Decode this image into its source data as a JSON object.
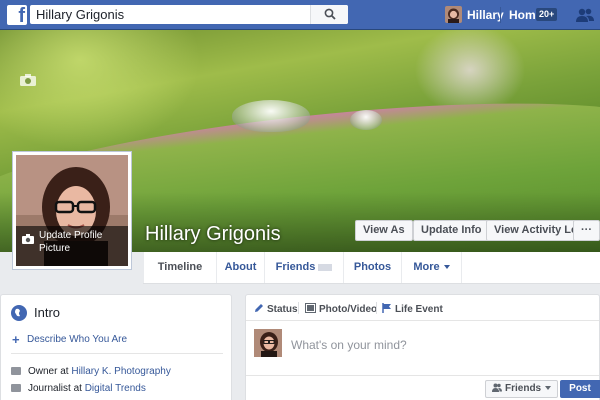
{
  "topbar": {
    "logo_letter": "f",
    "search_value": "Hillary Grigonis",
    "user_name": "Hillary",
    "home_label": "Home",
    "home_badge": "20+"
  },
  "profile": {
    "name": "Hillary Grigonis",
    "update_picture_label": "Update Profile Picture"
  },
  "cover_buttons": {
    "view_as": "View As",
    "update_info": "Update Info",
    "activity_log": "View Activity Log",
    "more_dots": "···"
  },
  "nav": {
    "timeline": "Timeline",
    "about": "About",
    "friends": "Friends",
    "photos": "Photos",
    "more": "More"
  },
  "intro": {
    "title": "Intro",
    "describe_plus": "+",
    "describe_link": "Describe Who You Are",
    "work": [
      {
        "role": "Owner at ",
        "place": "Hillary K. Photography"
      },
      {
        "role": "Journalist at ",
        "place": "Digital Trends"
      }
    ]
  },
  "composer": {
    "tabs": [
      "Status",
      "Photo/Video",
      "Life Event"
    ],
    "prompt": "What's on your mind?",
    "audience_label": "Friends",
    "post_label": "Post"
  },
  "colors": {
    "brand": "#4267b2",
    "link": "#365899"
  },
  "icons": [
    "facebook-logo",
    "search-icon",
    "friend-requests-icon",
    "camera-icon",
    "globe-icon",
    "briefcase-icon",
    "pencil-icon",
    "photo-icon",
    "flag-icon",
    "people-icon",
    "chevron-down-icon"
  ]
}
